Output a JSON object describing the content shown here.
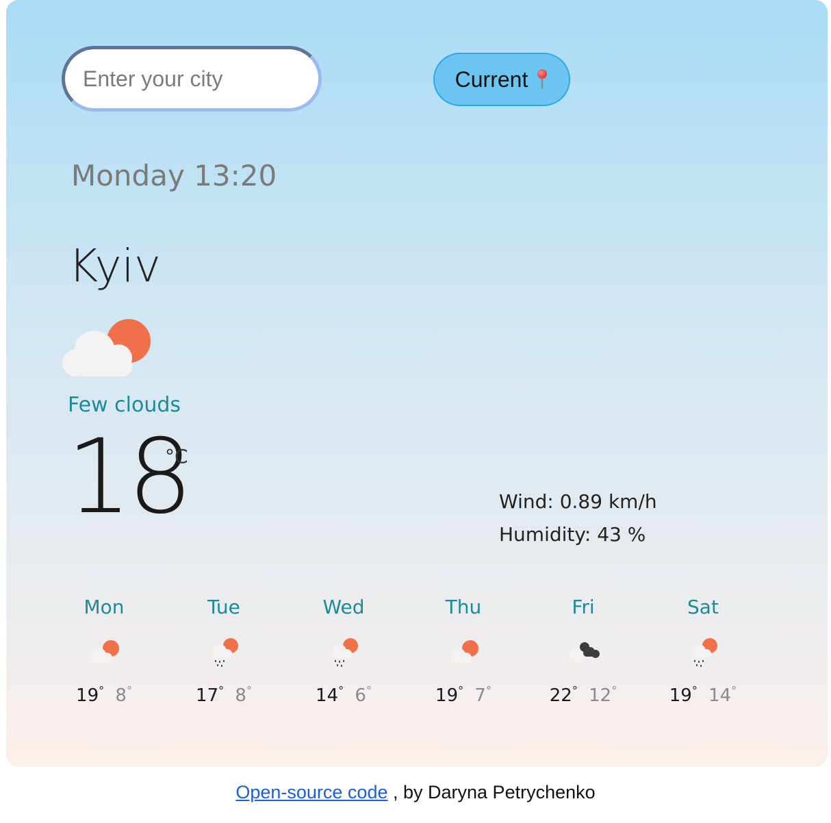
{
  "search": {
    "placeholder": "Enter your city",
    "value": ""
  },
  "current_button": {
    "label": "Current"
  },
  "weather": {
    "datetime": "Monday 13:20",
    "city": "Kyiv",
    "icon": "few-clouds-icon",
    "description": "Few clouds",
    "temperature": "18",
    "unit": "°C",
    "wind": "Wind: 0.89 km/h",
    "humidity": "Humidity: 43 %"
  },
  "forecast": [
    {
      "day": "Mon",
      "icon": "few-clouds-icon",
      "max": "19",
      "min": "8"
    },
    {
      "day": "Tue",
      "icon": "rain-sun-icon",
      "max": "17",
      "min": "8"
    },
    {
      "day": "Wed",
      "icon": "rain-sun-icon",
      "max": "14",
      "min": "6"
    },
    {
      "day": "Thu",
      "icon": "few-clouds-icon",
      "max": "19",
      "min": "7"
    },
    {
      "day": "Fri",
      "icon": "dark-clouds-icon",
      "max": "22",
      "min": "12"
    },
    {
      "day": "Sat",
      "icon": "rain-sun-icon",
      "max": "19",
      "min": "14"
    }
  ],
  "footer": {
    "link_text": "Open-source code",
    "author_text": ", by Daryna Petrychenko"
  },
  "colors": {
    "accent": "#1b8a99",
    "button_bg": "#6cc4f1",
    "sun": "#f0704a",
    "link": "#1a5fe0"
  }
}
